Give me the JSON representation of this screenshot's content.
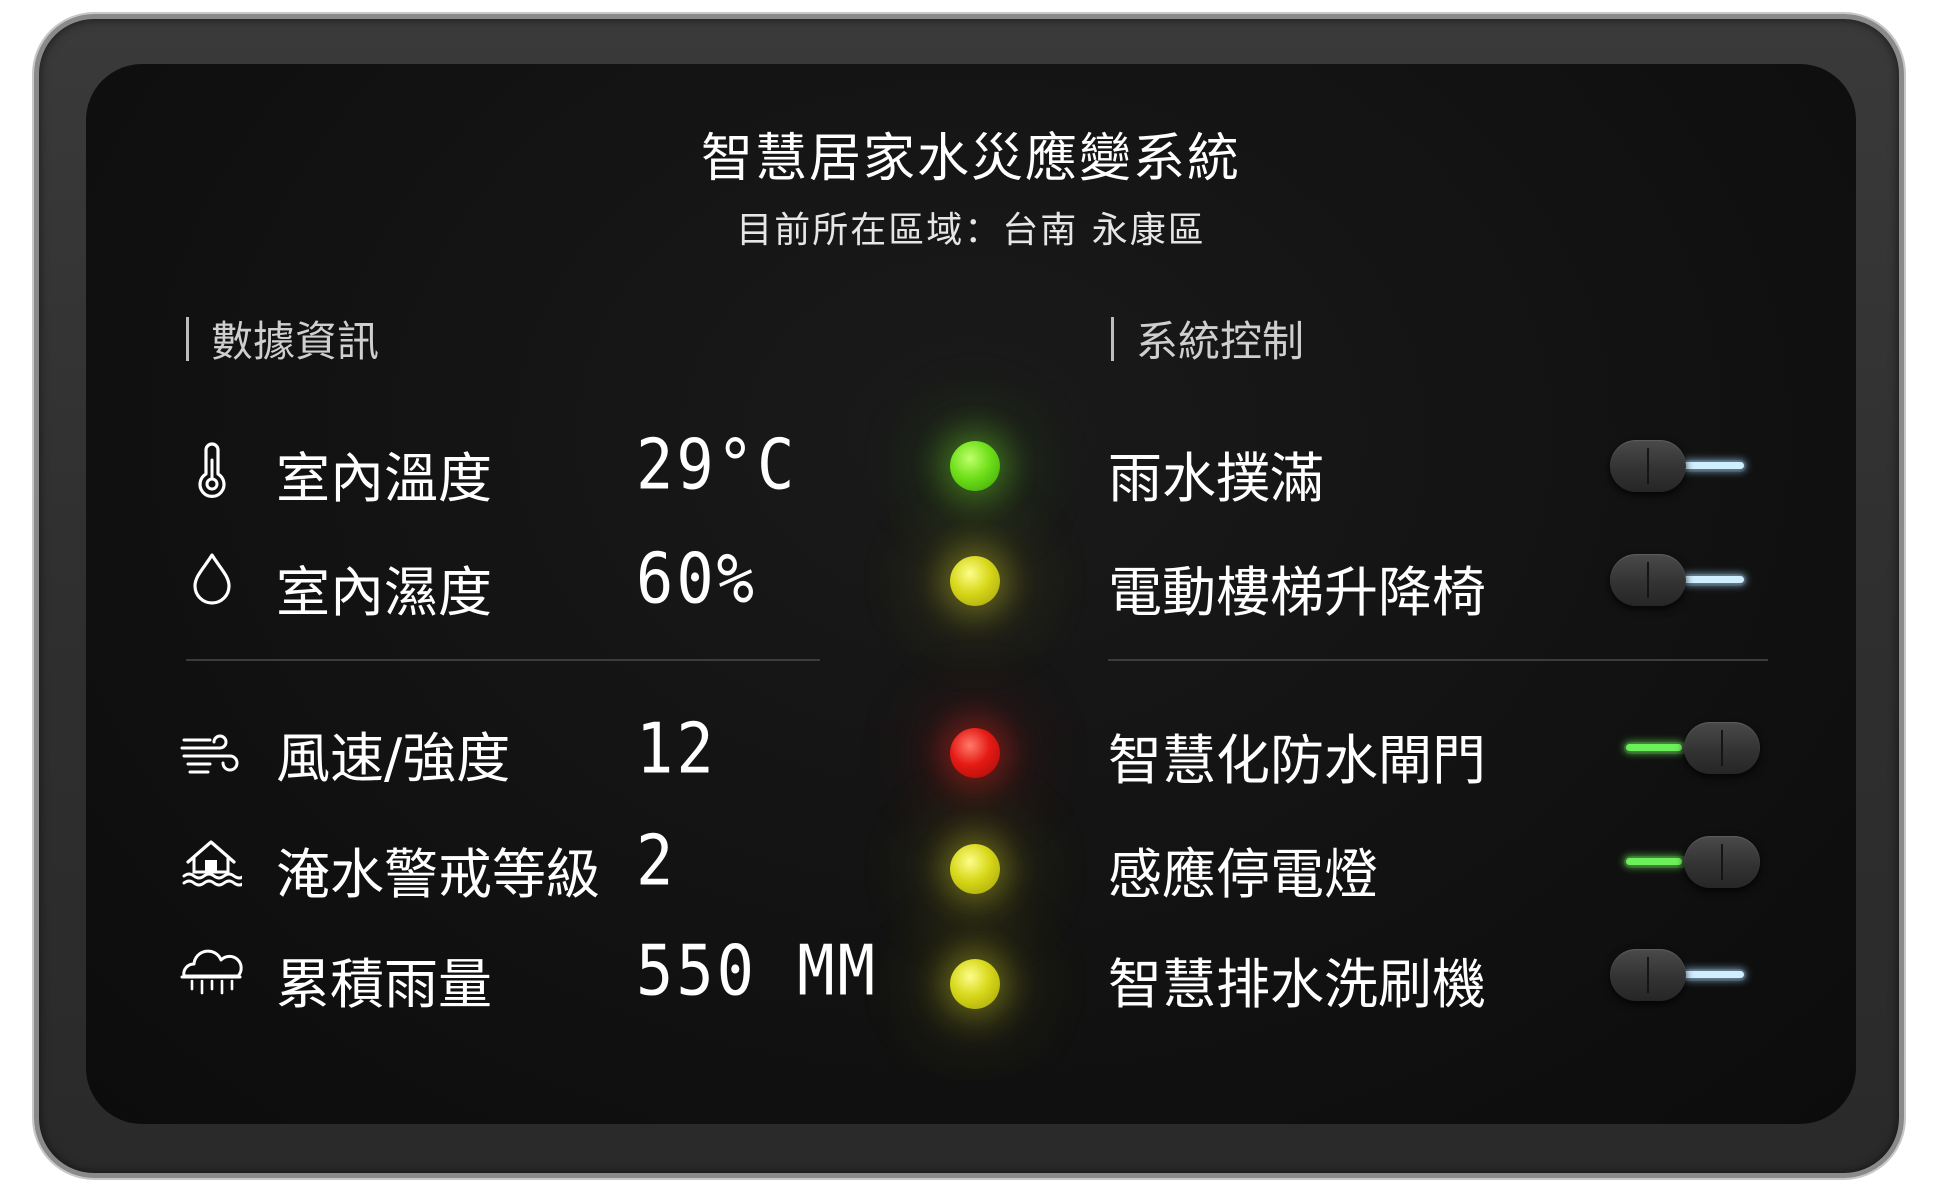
{
  "header": {
    "title": "智慧居家水災應變系統",
    "location": "目前所在區域：台南 永康區"
  },
  "data_panel": {
    "heading": "數據資訊",
    "rows": [
      {
        "icon": "thermometer-icon",
        "label": "室內溫度",
        "value": "29°C",
        "status": "green"
      },
      {
        "icon": "water-drop-icon",
        "label": "室內濕度",
        "value": "60%",
        "status": "yellow"
      },
      {
        "icon": "wind-icon",
        "label": "風速/強度",
        "value": "12",
        "status": "red"
      },
      {
        "icon": "flooded-house-icon",
        "label": "淹水警戒等級",
        "value": "2",
        "status": "yellow"
      },
      {
        "icon": "rain-cloud-icon",
        "label": "累積雨量",
        "value": "550 MM",
        "status": "yellow"
      }
    ]
  },
  "control_panel": {
    "heading": "系統控制",
    "controls": [
      {
        "label": "雨水撲滿",
        "on": false
      },
      {
        "label": "電動樓梯升降椅",
        "on": false
      },
      {
        "label": "智慧化防水閘門",
        "on": true
      },
      {
        "label": "感應停電燈",
        "on": true
      },
      {
        "label": "智慧排水洗刷機",
        "on": false
      }
    ]
  },
  "colors": {
    "led_green": "#6fe01a",
    "led_yellow": "#d7d71a",
    "led_red": "#e51a14",
    "toggle_on": "#6cf05a",
    "toggle_off": "#cfeeff"
  }
}
